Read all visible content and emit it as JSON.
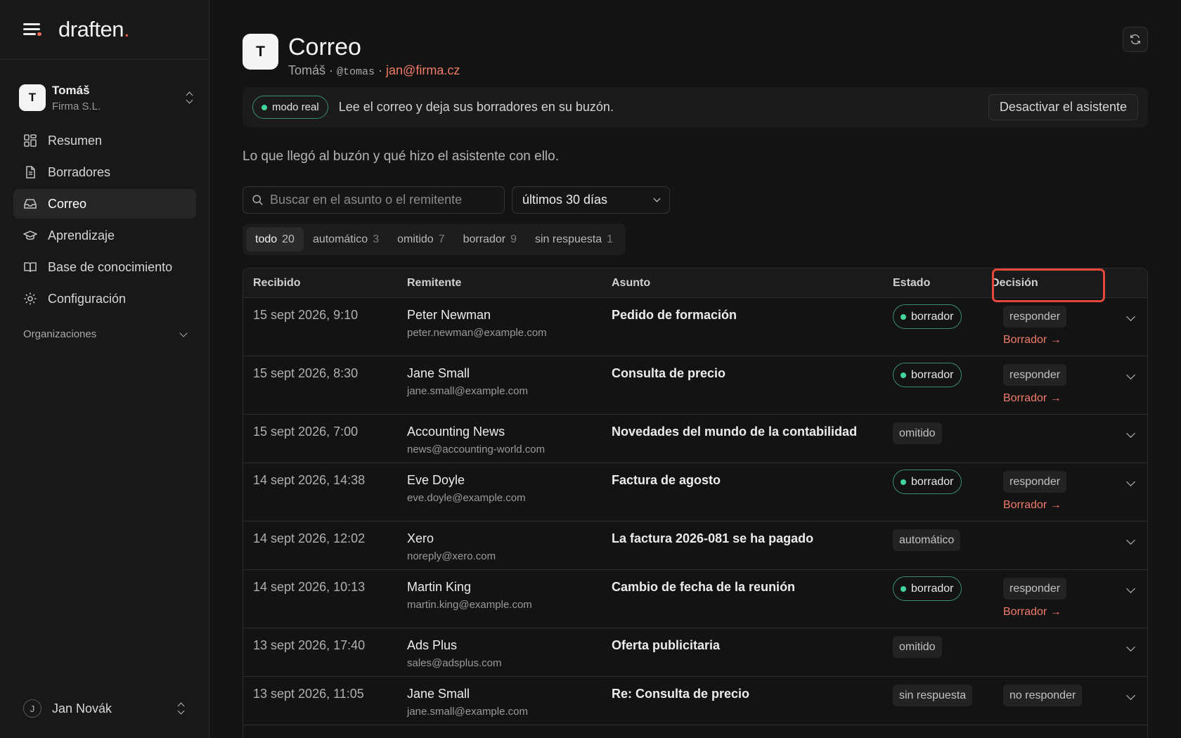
{
  "brand": {
    "name": "draften",
    "dot": "."
  },
  "account": {
    "initial": "T",
    "name": "Tomáš",
    "org": "Firma S.L."
  },
  "nav": {
    "items": [
      {
        "label": "Resumen",
        "icon": "dashboard-icon"
      },
      {
        "label": "Borradores",
        "icon": "document-icon"
      },
      {
        "label": "Correo",
        "icon": "inbox-icon",
        "active": true
      },
      {
        "label": "Aprendizaje",
        "icon": "graduation-cap-icon"
      },
      {
        "label": "Base de conocimiento",
        "icon": "book-icon"
      },
      {
        "label": "Configuración",
        "icon": "gear-icon"
      }
    ],
    "orgs_label": "Organizaciones"
  },
  "user": {
    "initial": "J",
    "name": "Jan Novák"
  },
  "header": {
    "initial": "T",
    "title": "Correo",
    "name": "Tomáš",
    "sep1": " · ",
    "handle": "@tomas",
    "sep2": " · ",
    "email": "jan@firma.cz"
  },
  "banner": {
    "mode": "modo real",
    "message": "Lee el correo y deja sus borradores en su buzón.",
    "deactivate": "Desactivar el asistente"
  },
  "intro": "Lo que llegó al buzón y qué hizo el asistente con ello.",
  "search": {
    "placeholder": "Buscar en el asunto o el remitente"
  },
  "range": {
    "selected": "últimos 30 días"
  },
  "tabs": [
    {
      "label": "todo",
      "count": "20",
      "active": true
    },
    {
      "label": "automático",
      "count": "3"
    },
    {
      "label": "omitido",
      "count": "7"
    },
    {
      "label": "borrador",
      "count": "9"
    },
    {
      "label": "sin respuesta",
      "count": "1"
    }
  ],
  "table": {
    "headers": {
      "received": "Recibido",
      "sender": "Remitente",
      "subject": "Asunto",
      "state": "Estado",
      "decision": "Decisión"
    },
    "draft_link": "Borrador →",
    "rows": [
      {
        "received": "15 sept 2026, 9:10",
        "name": "Peter Newman",
        "email": "peter.newman@example.com",
        "subject": "Pedido de formación",
        "state": "borrador",
        "decision": "responder",
        "draft": true
      },
      {
        "received": "15 sept 2026, 8:30",
        "name": "Jane Small",
        "email": "jane.small@example.com",
        "subject": "Consulta de precio",
        "state": "borrador",
        "decision": "responder",
        "draft": true
      },
      {
        "received": "15 sept 2026, 7:00",
        "name": "Accounting News",
        "email": "news@accounting-world.com",
        "subject": "Novedades del mundo de la contabilidad",
        "state": "omitido",
        "decision": "",
        "draft": false
      },
      {
        "received": "14 sept 2026, 14:38",
        "name": "Eve Doyle",
        "email": "eve.doyle@example.com",
        "subject": "Factura de agosto",
        "state": "borrador",
        "decision": "responder",
        "draft": true
      },
      {
        "received": "14 sept 2026, 12:02",
        "name": "Xero",
        "email": "noreply@xero.com",
        "subject": "La factura 2026-081 se ha pagado",
        "state": "automático",
        "decision": "",
        "draft": false
      },
      {
        "received": "14 sept 2026, 10:13",
        "name": "Martin King",
        "email": "martin.king@example.com",
        "subject": "Cambio de fecha de la reunión",
        "state": "borrador",
        "decision": "responder",
        "draft": true
      },
      {
        "received": "13 sept 2026, 17:40",
        "name": "Ads Plus",
        "email": "sales@adsplus.com",
        "subject": "Oferta publicitaria",
        "state": "omitido",
        "decision": "",
        "draft": false
      },
      {
        "received": "13 sept 2026, 11:05",
        "name": "Jane Small",
        "email": "jane.small@example.com",
        "subject": "Re: Consulta de precio",
        "state": "sin respuesta",
        "decision": "no responder",
        "draft": false
      }
    ]
  },
  "colors": {
    "accent": "#ef7b68",
    "brand_dot": "#ef5a4a",
    "success": "#43d69a",
    "highlight": "#e5483a"
  }
}
